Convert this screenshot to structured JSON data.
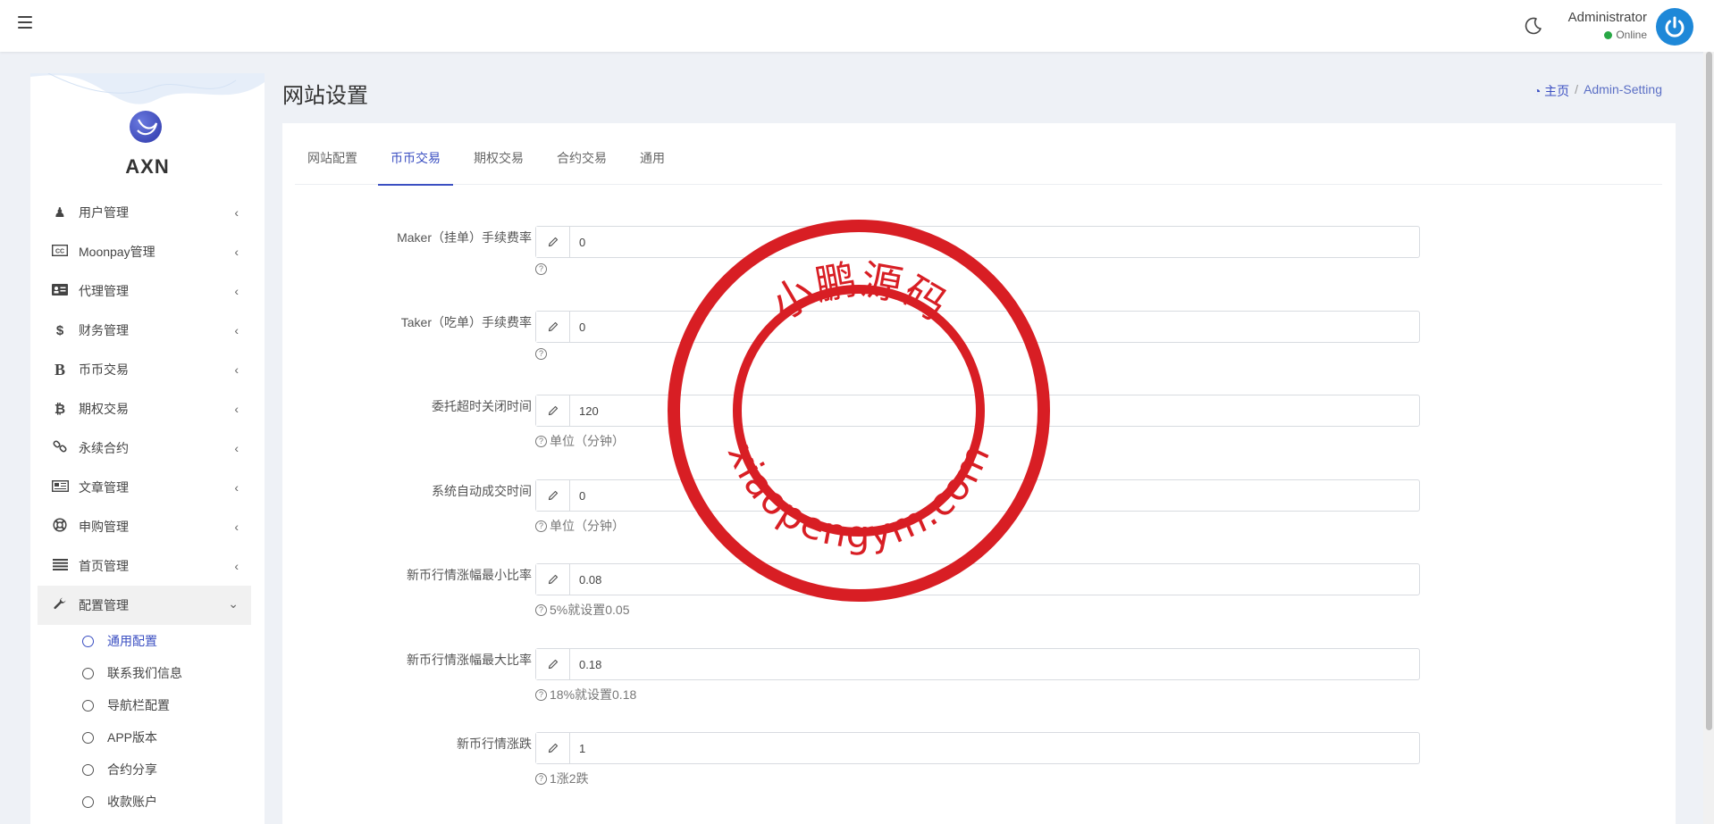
{
  "header": {
    "user_name": "Administrator",
    "user_status": "Online",
    "status_color": "#28a745",
    "avatar_color": "#1e88d8"
  },
  "sidebar": {
    "logo_text": "AXN",
    "items": [
      {
        "label": "用户管理",
        "icon": "user-secret-icon"
      },
      {
        "label": "Moonpay管理",
        "icon": "cc-icon"
      },
      {
        "label": "代理管理",
        "icon": "id-card-icon"
      },
      {
        "label": "财务管理",
        "icon": "dollar-icon"
      },
      {
        "label": "币币交易",
        "icon": "bold-b-icon"
      },
      {
        "label": "期权交易",
        "icon": "bitcoin-icon"
      },
      {
        "label": "永续合约",
        "icon": "link-icon"
      },
      {
        "label": "文章管理",
        "icon": "newspaper-icon"
      },
      {
        "label": "申购管理",
        "icon": "life-ring-icon"
      },
      {
        "label": "首页管理",
        "icon": "list-icon"
      },
      {
        "label": "配置管理",
        "icon": "wrench-icon"
      }
    ],
    "sub_items": [
      {
        "label": "通用配置"
      },
      {
        "label": "联系我们信息"
      },
      {
        "label": "导航栏配置"
      },
      {
        "label": "APP版本"
      },
      {
        "label": "合约分享"
      },
      {
        "label": "收款账户"
      }
    ]
  },
  "page": {
    "title": "网站设置",
    "breadcrumb_home": "主页",
    "breadcrumb_separator": "/",
    "breadcrumb_current": "Admin-Setting"
  },
  "tabs": [
    {
      "label": "网站配置"
    },
    {
      "label": "币币交易"
    },
    {
      "label": "期权交易"
    },
    {
      "label": "合约交易"
    },
    {
      "label": "通用"
    }
  ],
  "form": {
    "fields": [
      {
        "label": "Maker（挂单）手续费率",
        "value": "0",
        "help": ""
      },
      {
        "label": "Taker（吃单）手续费率",
        "value": "0",
        "help": ""
      },
      {
        "label": "委托超时关闭时间",
        "value": "120",
        "help": "单位（分钟）"
      },
      {
        "label": "系统自动成交时间",
        "value": "0",
        "help": "单位（分钟）"
      },
      {
        "label": "新币行情涨幅最小比率",
        "value": "0.08",
        "help": "5%就设置0.05"
      },
      {
        "label": "新币行情涨幅最大比率",
        "value": "0.18",
        "help": "18%就设置0.18"
      },
      {
        "label": "新币行情涨跌",
        "value": "1",
        "help": "1涨2跌"
      }
    ]
  },
  "watermark": {
    "top_text": "小鹏源码",
    "bottom_text": "xiaopengym.com",
    "color": "#d81e24"
  },
  "colors": {
    "accent": "#3b4fc2",
    "background": "#eef1f6"
  }
}
